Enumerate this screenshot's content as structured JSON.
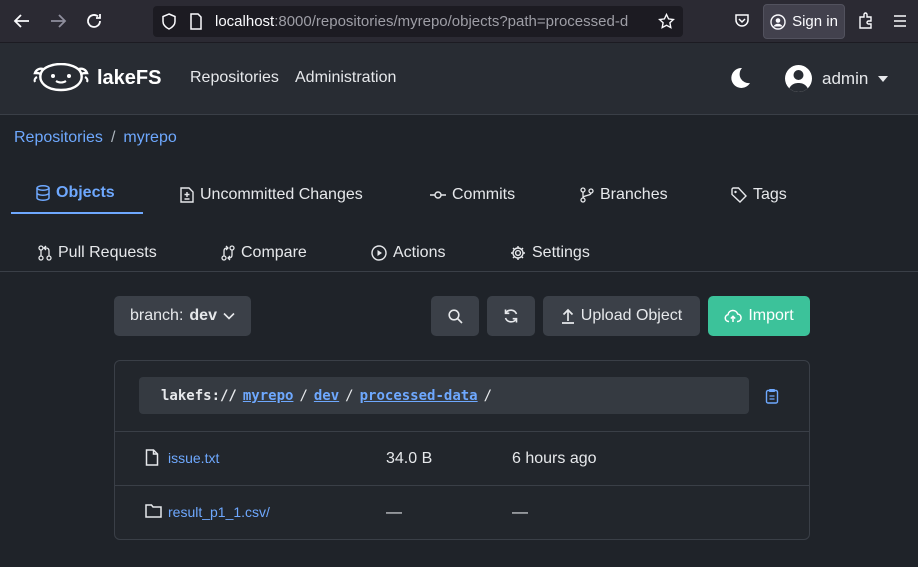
{
  "browser": {
    "url_host": "localhost",
    "url_rest": ":8000/repositories/myrepo/objects?path=processed-d",
    "sign_in_label": "Sign in"
  },
  "app": {
    "logo_text": "lakeFS",
    "nav": {
      "repositories": "Repositories",
      "administration": "Administration"
    },
    "user_name": "admin"
  },
  "breadcrumb": {
    "root": "Repositories",
    "separator": "/",
    "repo": "myrepo"
  },
  "tabs": [
    {
      "label": "Objects",
      "icon": "database-icon",
      "active": true
    },
    {
      "label": "Uncommitted Changes",
      "icon": "diff-icon"
    },
    {
      "label": "Commits",
      "icon": "commit-icon"
    },
    {
      "label": "Branches",
      "icon": "branch-icon"
    },
    {
      "label": "Tags",
      "icon": "tag-icon"
    },
    {
      "label": "Pull Requests",
      "icon": "pull-request-icon"
    },
    {
      "label": "Compare",
      "icon": "compare-icon"
    },
    {
      "label": "Actions",
      "icon": "play-icon"
    },
    {
      "label": "Settings",
      "icon": "gear-icon"
    }
  ],
  "toolbar": {
    "branch_prefix": "branch:",
    "branch_name": "dev",
    "upload_label": "Upload Object",
    "import_label": "Import"
  },
  "path": {
    "prefix": "lakefs://",
    "repo": "myrepo",
    "branch": "dev",
    "folder": "processed-data",
    "sep": "/"
  },
  "objects": [
    {
      "type": "file",
      "name": "issue.txt",
      "size": "34.0 B",
      "modified": "6 hours ago"
    },
    {
      "type": "folder",
      "name": "result_p1_1.csv/",
      "size": "—",
      "modified": "—"
    }
  ],
  "colors": {
    "accent": "#6ea8fe",
    "import_green": "#3cc29a",
    "background": "#1f2329"
  }
}
